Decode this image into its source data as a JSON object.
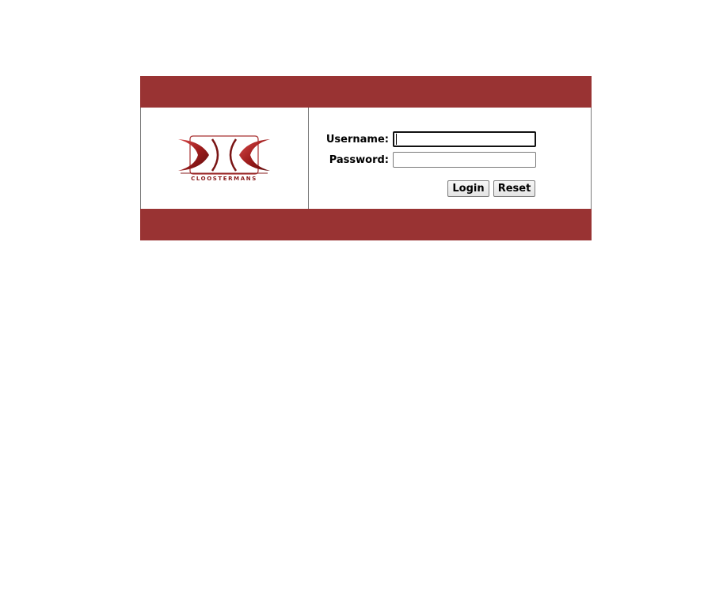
{
  "brand": {
    "name": "CLOOSTERMANS",
    "color": "#993333"
  },
  "form": {
    "username_label": "Username:",
    "username_value": "",
    "password_label": "Password:",
    "password_value": "",
    "login_label": "Login",
    "reset_label": "Reset"
  }
}
